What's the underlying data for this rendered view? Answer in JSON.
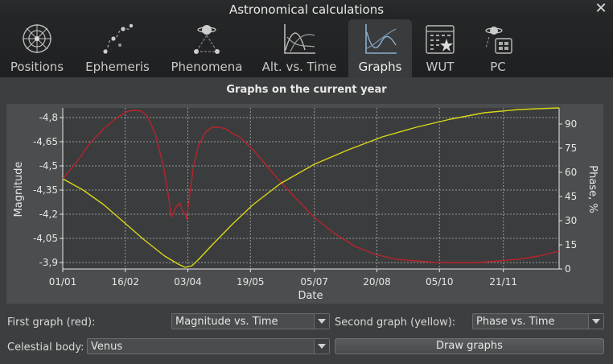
{
  "window": {
    "title": "Astronomical calculations"
  },
  "tabs": [
    {
      "label": "Positions",
      "icon": "positions-icon"
    },
    {
      "label": "Ephemeris",
      "icon": "ephemeris-icon"
    },
    {
      "label": "Phenomena",
      "icon": "phenomena-icon"
    },
    {
      "label": "Alt. vs. Time",
      "icon": "alt-vs-time-icon"
    },
    {
      "label": "Graphs",
      "icon": "graphs-icon",
      "active": true
    },
    {
      "label": "WUT",
      "icon": "wut-icon"
    },
    {
      "label": "PC",
      "icon": "pc-icon"
    }
  ],
  "graphs": {
    "title": "Graphs on the current year",
    "first_graph_label": "First graph (red):",
    "first_graph_value": "Magnitude vs. Time",
    "second_graph_label": "Second graph (yellow):",
    "second_graph_value": "Phase vs. Time",
    "body_label": "Celestial body:",
    "body_value": "Venus",
    "draw_button": "Draw graphs"
  },
  "chart_data": {
    "type": "line",
    "xlabel": "Date",
    "ylabel": "Magnitude",
    "y2label": "Phase, %",
    "x_ticks": [
      "01/01",
      "16/02",
      "03/04",
      "19/05",
      "05/07",
      "20/08",
      "05/10",
      "21/11"
    ],
    "x_tick_days": [
      0,
      46,
      92,
      138,
      185,
      231,
      277,
      324
    ],
    "xlim": [
      0,
      365
    ],
    "y_ticks": [
      "-4,8",
      "-4,65",
      "-4,5",
      "-4,35",
      "-4,2",
      "-4,05",
      "-3,9"
    ],
    "ylim": [
      -3.86,
      -4.86
    ],
    "y2_ticks": [
      "90",
      "75",
      "60",
      "45",
      "30",
      "15",
      "0"
    ],
    "y2lim": [
      0,
      100
    ],
    "grid": true,
    "colors": {
      "red": "#b8242c",
      "yellow": "#d8d81a"
    },
    "series": [
      {
        "axis": "left",
        "color": "#b8242c",
        "x": [
          0,
          10,
          20,
          30,
          40,
          48,
          52,
          58,
          62,
          68,
          74,
          78,
          80,
          83,
          86,
          88,
          90,
          91,
          93,
          96,
          100,
          105,
          110,
          115,
          120,
          125,
          130,
          140,
          155,
          170,
          185,
          200,
          215,
          230,
          245,
          260,
          275,
          290,
          305,
          320,
          335,
          350,
          365
        ],
        "y": [
          -4.42,
          -4.52,
          -4.64,
          -4.73,
          -4.8,
          -4.84,
          -4.845,
          -4.84,
          -4.81,
          -4.7,
          -4.5,
          -4.3,
          -4.18,
          -4.24,
          -4.27,
          -4.22,
          -4.2,
          -4.17,
          -4.29,
          -4.49,
          -4.63,
          -4.71,
          -4.74,
          -4.74,
          -4.73,
          -4.7,
          -4.68,
          -4.6,
          -4.45,
          -4.31,
          -4.18,
          -4.08,
          -4.0,
          -3.95,
          -3.92,
          -3.91,
          -3.9,
          -3.9,
          -3.9,
          -3.91,
          -3.92,
          -3.94,
          -3.97
        ]
      },
      {
        "axis": "right",
        "color": "#d8d81a",
        "x": [
          0,
          15,
          30,
          45,
          60,
          75,
          85,
          90,
          95,
          100,
          110,
          125,
          140,
          160,
          185,
          210,
          235,
          260,
          285,
          310,
          335,
          365
        ],
        "y": [
          56,
          49,
          40,
          29,
          18,
          8,
          3,
          1,
          2,
          6,
          15,
          28,
          40,
          53,
          65,
          74,
          82,
          88,
          93,
          97,
          99,
          100
        ]
      }
    ]
  }
}
